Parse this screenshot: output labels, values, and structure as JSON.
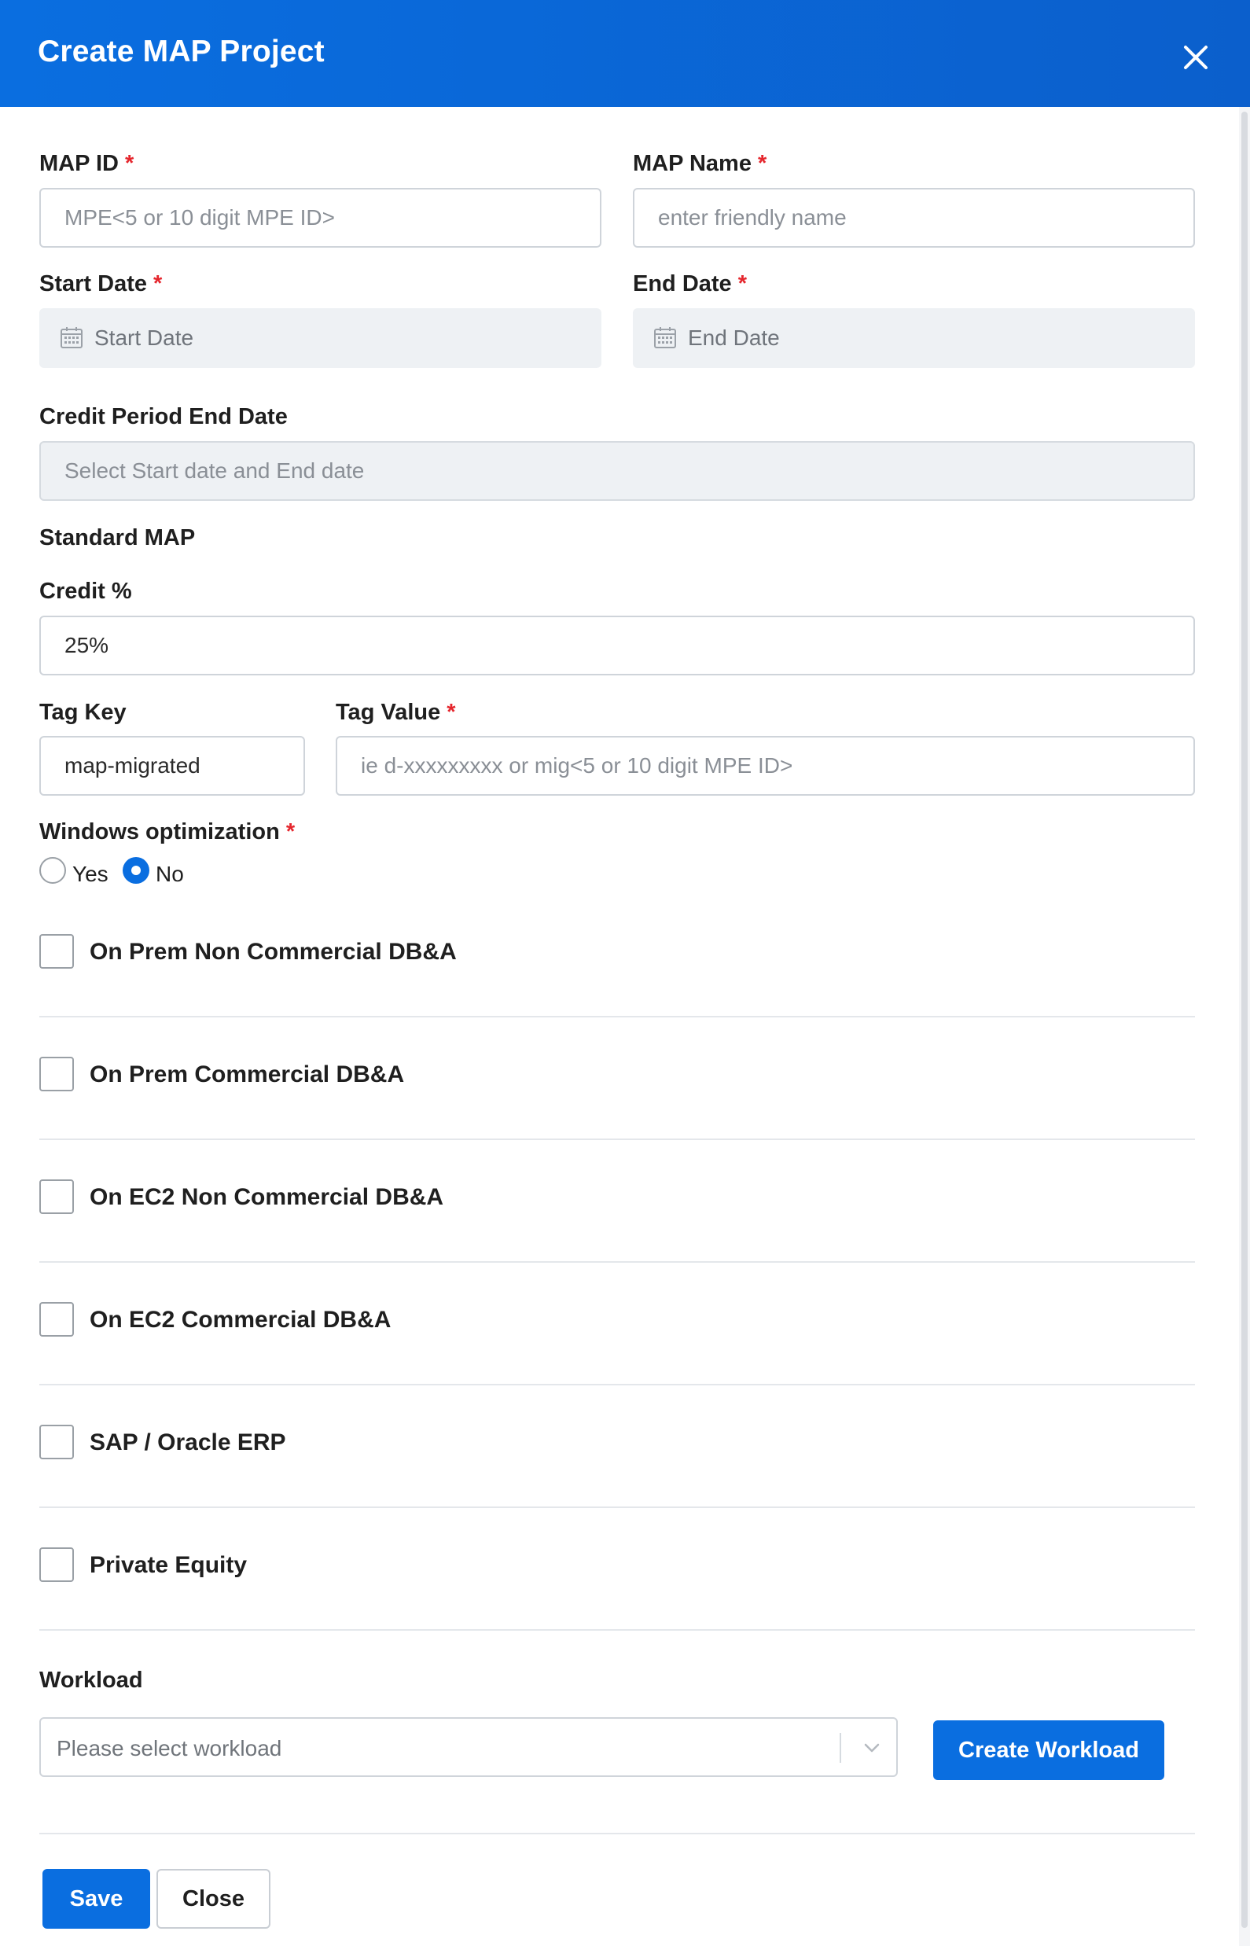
{
  "header": {
    "title": "Create MAP Project",
    "close_icon": "close-icon"
  },
  "fields": {
    "map_id": {
      "label": "MAP ID",
      "required": "*",
      "placeholder": "MPE<5 or 10 digit MPE ID>"
    },
    "map_name": {
      "label": "MAP Name",
      "required": "*",
      "placeholder": "enter friendly name"
    },
    "start_date": {
      "label": "Start Date",
      "required": "*",
      "placeholder": "Start Date"
    },
    "end_date": {
      "label": "End Date",
      "required": "*",
      "placeholder": "End Date"
    },
    "credit_period_end": {
      "label": "Credit Period End Date",
      "placeholder": "Select Start date and End date"
    },
    "section_label": "Standard MAP",
    "credit": {
      "label": "Credit %",
      "value": "25%"
    },
    "tag_key": {
      "label": "Tag Key",
      "value": "map-migrated"
    },
    "tag_value": {
      "label": "Tag Value",
      "required": "*",
      "placeholder": "ie d-xxxxxxxxx or mig<5 or 10 digit MPE ID>"
    },
    "windows_optimization": {
      "label": "Windows optimization",
      "required": "*",
      "options": [
        "Yes",
        "No"
      ],
      "selected": "No"
    }
  },
  "checkboxes": [
    {
      "label": "On Prem Non Commercial DB&A",
      "checked": false
    },
    {
      "label": "On Prem Commercial DB&A",
      "checked": false
    },
    {
      "label": "On EC2 Non Commercial DB&A",
      "checked": false
    },
    {
      "label": "On EC2 Commercial DB&A",
      "checked": false
    },
    {
      "label": "SAP / Oracle ERP",
      "checked": false
    },
    {
      "label": "Private Equity",
      "checked": false
    }
  ],
  "workload": {
    "label": "Workload",
    "placeholder": "Please select workload",
    "create_button": "Create Workload"
  },
  "footer": {
    "save_label": "Save",
    "close_label": "Close"
  },
  "colors": {
    "accent": "#0a6ee0",
    "required": "#e5262d",
    "disabled_bg": "#eef1f4"
  }
}
